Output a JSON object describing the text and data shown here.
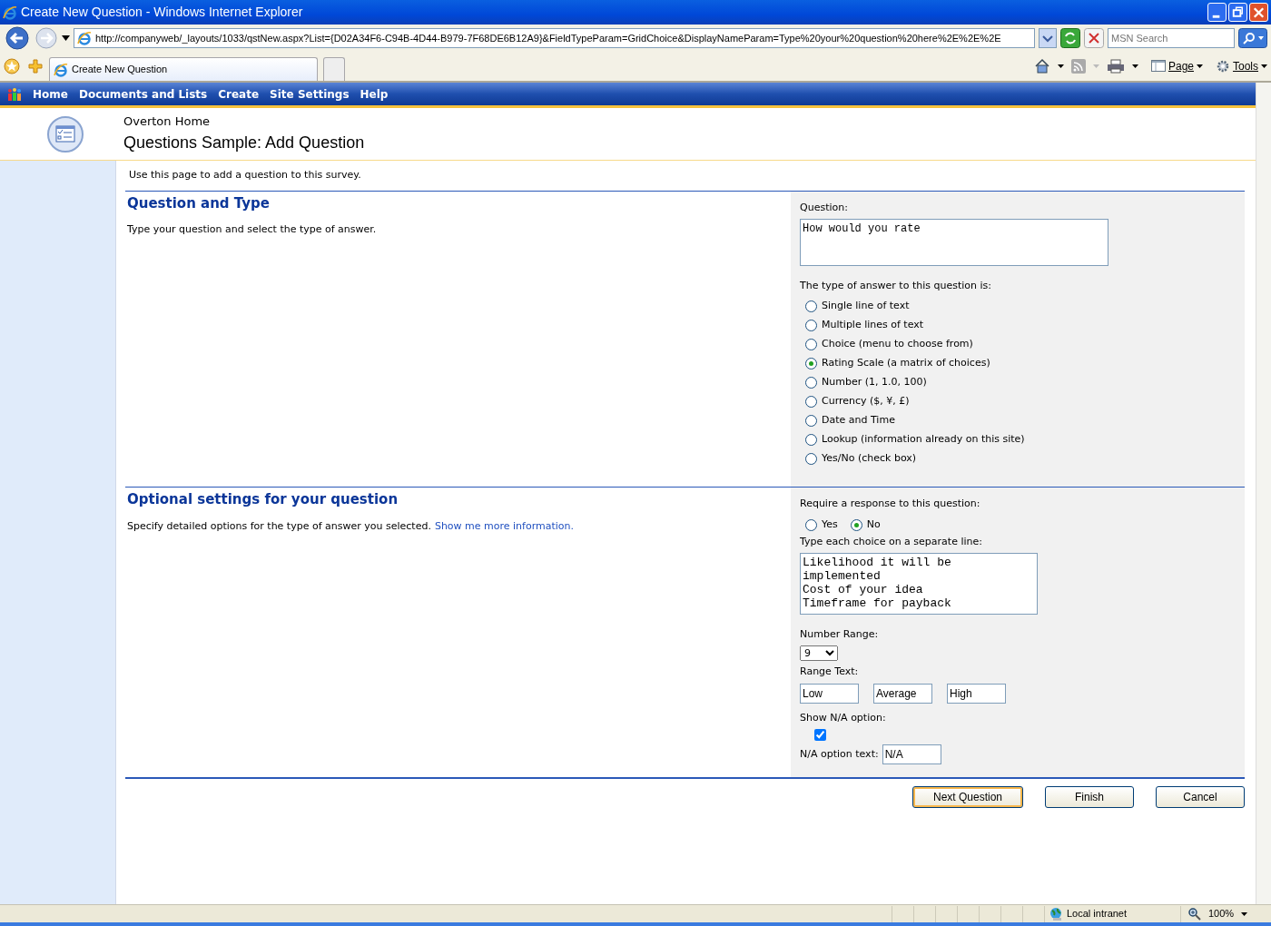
{
  "window": {
    "title": "Create New Question - Windows Internet Explorer"
  },
  "address_bar": {
    "url": "http://companyweb/_layouts/1033/qstNew.aspx?List={D02A34F6-C94B-4D44-B979-7F68DE6B12A9}&FieldTypeParam=GridChoice&DisplayNameParam=Type%20your%20question%20here%2E%2E%2E"
  },
  "search": {
    "placeholder": "MSN Search"
  },
  "tabs": [
    {
      "label": "Create New Question",
      "selected": true
    }
  ],
  "command_bar": [
    {
      "label": "Page",
      "kind": "page"
    },
    {
      "label": "Tools",
      "kind": "tools"
    }
  ],
  "site_nav": [
    "Home",
    "Documents and Lists",
    "Create",
    "Site Settings",
    "Help"
  ],
  "header": {
    "site": "Overton Home",
    "title": "Questions Sample: Add Question"
  },
  "intro": "Use this page to add a question to this survey.",
  "section_1": {
    "title": "Question and Type",
    "description": "Type your question and select the type of answer.",
    "question": {
      "label": "Question:",
      "value": "How would you rate"
    },
    "answer_type": {
      "label": "The type of answer to this question is:",
      "options": [
        {
          "label": "Single line of text",
          "selected": false
        },
        {
          "label": "Multiple lines of text",
          "selected": false
        },
        {
          "label": "Choice (menu to choose from)",
          "selected": false
        },
        {
          "label": "Rating Scale (a matrix of choices)",
          "selected": true
        },
        {
          "label": "Number (1, 1.0, 100)",
          "selected": false
        },
        {
          "label": "Currency ($, ¥, £)",
          "selected": false
        },
        {
          "label": "Date and Time",
          "selected": false
        },
        {
          "label": "Lookup (information already on this site)",
          "selected": false
        },
        {
          "label": "Yes/No (check box)",
          "selected": false
        }
      ]
    }
  },
  "section_2": {
    "title": "Optional settings for your question",
    "description": "Specify detailed options for the type of answer you selected.",
    "link": "Show me more information.",
    "require": {
      "label": "Require a response to this question:",
      "options": [
        {
          "label": "Yes",
          "selected": false
        },
        {
          "label": "No",
          "selected": true
        }
      ]
    },
    "choices": {
      "label": "Type each choice on a separate line:",
      "lines": [
        "Likelihood it will be implemented",
        "Cost of your idea",
        "Timeframe for payback"
      ]
    },
    "number_range": {
      "label": "Number Range:",
      "value": "9"
    },
    "range_text": {
      "label": "Range Text:",
      "values": [
        "Low",
        "Average",
        "High"
      ]
    },
    "show_na": {
      "label": "Show N/A option:",
      "checked": true
    },
    "na_text": {
      "label": "N/A option text:",
      "value": "N/A"
    }
  },
  "buttons": [
    {
      "label": "Next Question",
      "default": true
    },
    {
      "label": "Finish",
      "default": false
    },
    {
      "label": "Cancel",
      "default": false
    }
  ],
  "status_bar": {
    "zone": "Local intranet",
    "zoom": "100%"
  }
}
